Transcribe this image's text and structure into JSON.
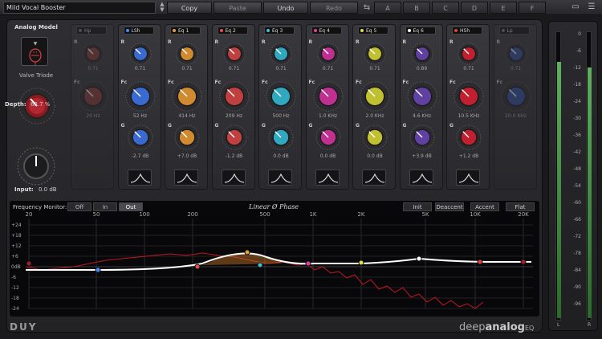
{
  "topbar": {
    "preset_name": "Mild Vocal Booster",
    "copy": "Copy",
    "paste": "Paste",
    "undo": "Undo",
    "redo": "Redo",
    "slots": [
      "A",
      "B",
      "C",
      "D",
      "E",
      "F"
    ]
  },
  "model": {
    "title": "Analog Model",
    "name": "Valve Triode",
    "depth_label": "Depth:",
    "depth_value": "62.7 %",
    "input_label": "Input:",
    "input_value": "0.0 dB"
  },
  "bands": [
    {
      "name": "Hp",
      "led": "#777",
      "enabled": false,
      "r": "0.71",
      "fc": "20 Hz",
      "g": "",
      "knob_color": "#8a3a3a"
    },
    {
      "name": "LSh",
      "led": "#4a8aff",
      "enabled": true,
      "r": "0.71",
      "fc": "52 Hz",
      "g": "-2.7 dB",
      "knob_color": "#3a6ad0"
    },
    {
      "name": "Eq 1",
      "led": "#e0a040",
      "enabled": true,
      "r": "0.71",
      "fc": "414 Hz",
      "g": "+7.0 dB",
      "knob_color": "#d08a30"
    },
    {
      "name": "Eq 2",
      "led": "#e05050",
      "enabled": true,
      "r": "0.71",
      "fc": "209 Hz",
      "g": "-1.2 dB",
      "knob_color": "#c04040"
    },
    {
      "name": "Eq 3",
      "led": "#40c0d0",
      "enabled": true,
      "r": "0.71",
      "fc": "500 Hz",
      "g": "0.0 dB",
      "knob_color": "#30a8c0"
    },
    {
      "name": "Eq 4",
      "led": "#e040a0",
      "enabled": true,
      "r": "0.71",
      "fc": "1.0 KHz",
      "g": "0.0 dB",
      "knob_color": "#c03090"
    },
    {
      "name": "Eq 5",
      "led": "#e0e040",
      "enabled": true,
      "r": "0.71",
      "fc": "2.0 KHz",
      "g": "0.0 dB",
      "knob_color": "#c0c030"
    },
    {
      "name": "Eq 6",
      "led": "#ffffff",
      "enabled": true,
      "r": "0.89",
      "fc": "4.6 KHz",
      "g": "+3.9 dB",
      "knob_color": "#6040a0"
    },
    {
      "name": "HSh",
      "led": "#e04040",
      "enabled": true,
      "r": "0.71",
      "fc": "10.5 KHz",
      "g": "+1.2 dB",
      "knob_color": "#c02030"
    },
    {
      "name": "Lp",
      "led": "#777",
      "enabled": false,
      "r": "0.71",
      "fc": "20.0 KHz",
      "g": "",
      "knob_color": "#3050a0"
    }
  ],
  "labels": {
    "r": "R",
    "fc": "Fc",
    "g": "G"
  },
  "monitor": {
    "label": "Frequency Monitor:",
    "options": [
      "Off",
      "In",
      "Out"
    ],
    "selected": "Out",
    "phase": "Linear Ø Phase",
    "actions": [
      "Init",
      "Deaccent",
      "Accent",
      "Flat"
    ]
  },
  "graph": {
    "freq_ticks": [
      "20",
      "50",
      "100",
      "200",
      "500",
      "1K",
      "2K",
      "5K",
      "10K",
      "20K"
    ],
    "db_ticks": [
      "+24",
      "+18",
      "+12",
      "+6",
      "0dB",
      "-6",
      "-12",
      "-18",
      "-24"
    ]
  },
  "brand": "DUY",
  "product": {
    "deep": "deep",
    "analog": "analog",
    "eq": "EQ"
  },
  "meter": {
    "ticks": [
      "0",
      "-6",
      "-12",
      "-18",
      "-24",
      "-30",
      "-36",
      "-42",
      "-48",
      "-54",
      "-60",
      "-66",
      "-72",
      "-78",
      "-84",
      "-90",
      "-96"
    ],
    "left_label": "L",
    "right_label": "R",
    "left_level": 0.9,
    "right_level": 0.88
  }
}
